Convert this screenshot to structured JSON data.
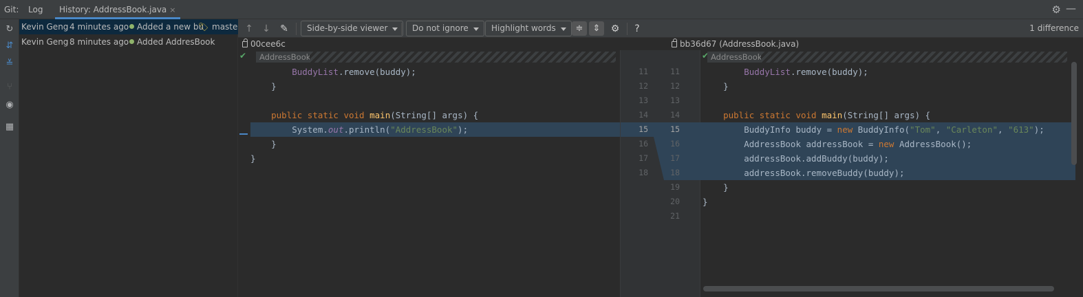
{
  "tabs": {
    "git_label": "Git:",
    "log": "Log",
    "history": "History: AddressBook.java",
    "close_glyph": "×"
  },
  "commits": [
    {
      "author": "Kevin Geng",
      "date": "4 minutes ago",
      "message": "Added a new bu",
      "branch": "master",
      "selected": true
    },
    {
      "author": "Kevin Geng",
      "date": "8 minutes ago",
      "message": "Added AddresBook",
      "branch": "",
      "selected": false
    }
  ],
  "toolbar": {
    "viewer": "Side-by-side viewer",
    "ignore": "Do not ignore",
    "highlight": "Highlight words",
    "help": "?",
    "difference_count": "1 difference"
  },
  "revisions": {
    "left": "00cee6c",
    "right": "bb36d67 (AddressBook.java)"
  },
  "breadcrumb": {
    "left": "AddressBook",
    "right": "AddressBook"
  },
  "left_code": [
    "        BuddyList.remove(buddy);",
    "    }",
    "",
    "    public static void main(String[] args) {",
    "        System.out.println(\"AddressBook\");",
    "    }",
    "}"
  ],
  "right_code": [
    "        BuddyList.remove(buddy);",
    "    }",
    "",
    "    public static void main(String[] args) {",
    "        BuddyInfo buddy = new BuddyInfo(\"Tom\", \"Carleton\", \"613\");",
    "        AddressBook addressBook = new AddressBook();",
    "        addressBook.addBuddy(buddy);",
    "        addressBook.removeBuddy(buddy);",
    "    }",
    "}",
    ""
  ],
  "gutter": {
    "left": [
      "11",
      "12",
      "13",
      "14",
      "15",
      "16",
      "17",
      "18"
    ],
    "right": [
      "11",
      "12",
      "13",
      "14",
      "15",
      "16",
      "17",
      "18",
      "19",
      "20",
      "21"
    ]
  },
  "colors": {
    "accent": "#4a88c7",
    "changed_bg": "#2f4457",
    "keyword": "#cc7832",
    "string": "#6a8759",
    "method": "#ffc66d"
  }
}
